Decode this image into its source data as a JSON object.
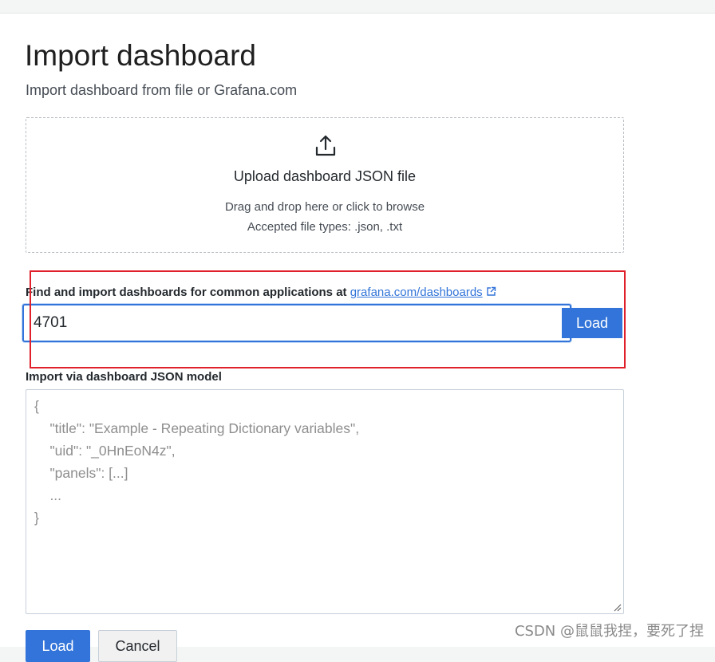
{
  "header": {
    "title": "Import dashboard",
    "subtitle": "Import dashboard from file or Grafana.com"
  },
  "upload": {
    "icon": "upload-icon",
    "title": "Upload dashboard JSON file",
    "hint": "Drag and drop here or click to browse",
    "accepted": "Accepted file types: .json, .txt"
  },
  "grafana_com": {
    "label": "Find and import dashboards for common applications at",
    "link_text": "grafana.com/dashboards",
    "link_icon": "external-link-icon",
    "input_value": "4701",
    "load_label": "Load"
  },
  "json_model": {
    "label": "Import via dashboard JSON model",
    "placeholder": "{\n    \"title\": \"Example - Repeating Dictionary variables\",\n    \"uid\": \"_0HnEoN4z\",\n    \"panels\": [...]\n    ...\n}"
  },
  "footer": {
    "load_label": "Load",
    "cancel_label": "Cancel"
  },
  "watermark": "CSDN @鼠鼠我捏，要死了捏",
  "colors": {
    "accent": "#3274d9",
    "highlight": "#e0212c"
  }
}
